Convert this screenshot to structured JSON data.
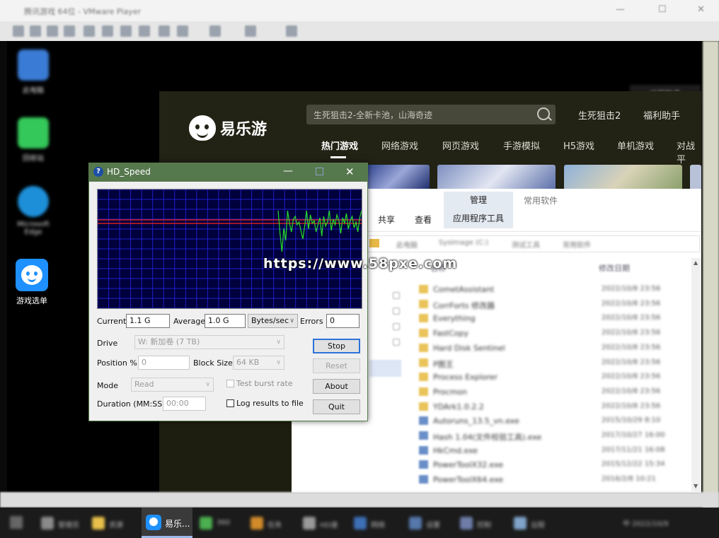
{
  "vm": {
    "title": "腾讯游戏 64位 - VMware Player",
    "min": "—",
    "max": "☐",
    "close": "✕",
    "toolbar_icons": [
      "play-icon",
      "pause-icon",
      "stop-icon",
      "snapshot-icon",
      "settings-icon",
      "usb-icon",
      "printer-icon",
      "network-icon",
      "display-icon",
      "sound-icon",
      "fullscreen-icon",
      "unity-icon",
      "help-icon"
    ]
  },
  "desktop": {
    "icons": [
      {
        "label": "此电脑",
        "color": "#3a7bd5"
      },
      {
        "label": "回收站",
        "color": "#34c759"
      },
      {
        "label": "Microsoft Edge",
        "color": "#1d8fd8"
      },
      {
        "label": "游戏选单",
        "color": "#1e90ff"
      }
    ],
    "helper": "远程助手"
  },
  "site": {
    "logo_text": "易乐游",
    "search_placeholder": "生死狙击2-全新卡池，山海奇迹",
    "top_links": [
      "生死狙击2",
      "福利助手"
    ],
    "nav": [
      "热门游戏",
      "网络游戏",
      "网页游戏",
      "手游模拟",
      "H5游戏",
      "单机游戏",
      "对战平"
    ]
  },
  "explorer": {
    "ribbon": {
      "manage": "管理",
      "app_tools": "应用程序工具",
      "common_software": "常用软件",
      "tabs": [
        "共享",
        "查看"
      ]
    },
    "address": [
      "此电脑",
      "SysImage (C:)",
      "测试工具",
      "常用软件"
    ],
    "columns": [
      "名称",
      "修改日期"
    ],
    "files": [
      {
        "name": "CometAssistant",
        "date": "2022/10/8 23:56"
      },
      {
        "name": "CorrForts 修改器",
        "date": "2022/10/8 23:56"
      },
      {
        "name": "Everything",
        "date": "2022/10/8 23:56"
      },
      {
        "name": "FastCopy",
        "date": "2022/10/8 23:56"
      },
      {
        "name": "Hard Disk Sentinel",
        "date": "2022/10/8 23:56"
      },
      {
        "name": "P图王",
        "date": "2022/10/8 23:56"
      },
      {
        "name": "Process Explorer",
        "date": "2022/10/8 23:56"
      },
      {
        "name": "Procmon",
        "date": "2022/10/8 23:56"
      },
      {
        "name": "YDArk1.0.2.2",
        "date": "2022/10/8 23:56"
      },
      {
        "name": "Autoruns_13.5_vn.exe",
        "date": "2015/10/29 8:10"
      },
      {
        "name": "Hash 1.04(文件校验工具).exe",
        "date": "2017/10/27 16:00"
      },
      {
        "name": "HkCmd.exe",
        "date": "2017/11/21 16:08"
      },
      {
        "name": "PowerToolX32.exe",
        "date": "2015/12/22 15:34"
      },
      {
        "name": "PowerToolX64.exe",
        "date": "2016/2/8 10:21"
      }
    ]
  },
  "taskbar": {
    "items": [
      {
        "label": "",
        "color": "#6f6f6f"
      },
      {
        "label": "管理员",
        "color": "#8a8a8a"
      },
      {
        "label": "资源",
        "color": "#e8c04a"
      },
      {
        "label": "易乐...",
        "color": "#1e90ff"
      },
      {
        "label": "360",
        "color": "#4caf50"
      },
      {
        "label": "任务",
        "color": "#d08a2a"
      },
      {
        "label": "HD速",
        "color": "#999"
      },
      {
        "label": "网络",
        "color": "#3d6fb5"
      },
      {
        "label": "设置",
        "color": "#5577aa"
      },
      {
        "label": "控制",
        "color": "#6d7da8"
      },
      {
        "label": "远程",
        "color": "#7fa3c9"
      }
    ],
    "tray": "中 2022/10/9"
  },
  "hd_speed": {
    "title": "HD_Speed",
    "help_icon": "?",
    "min": "—",
    "close": "✕",
    "graph": {
      "samples": [
        30,
        62,
        88,
        55,
        72,
        30,
        48,
        60,
        42,
        38,
        50,
        46,
        58,
        70,
        52,
        30,
        56,
        36,
        48,
        44,
        60,
        50,
        40,
        66,
        38,
        52,
        46,
        30,
        58,
        42,
        50,
        36,
        44,
        62,
        40,
        48,
        34,
        56,
        44,
        38,
        54,
        46,
        60,
        40,
        30
      ]
    },
    "current_label": "Current",
    "current_value": "1.1 G",
    "average_label": "Average",
    "average_value": "1.0 G",
    "unit": "Bytes/sec",
    "errors_label": "Errors",
    "errors_value": "0",
    "drive_label": "Drive",
    "drive_value": "W: 新加卷 (7 TB)",
    "position_label": "Position %",
    "position_value": "0",
    "block_label": "Block Size",
    "block_value": "64 KB",
    "mode_label": "Mode",
    "mode_value": "Read",
    "burst_label": "Test burst rate",
    "duration_label": "Duration (MM:SS)",
    "duration_value": "00:00",
    "log_label": "Log results to file",
    "buttons": {
      "stop": "Stop",
      "reset": "Reset",
      "about": "About",
      "quit": "Quit"
    }
  },
  "watermark": "https://www.58pxe.com"
}
